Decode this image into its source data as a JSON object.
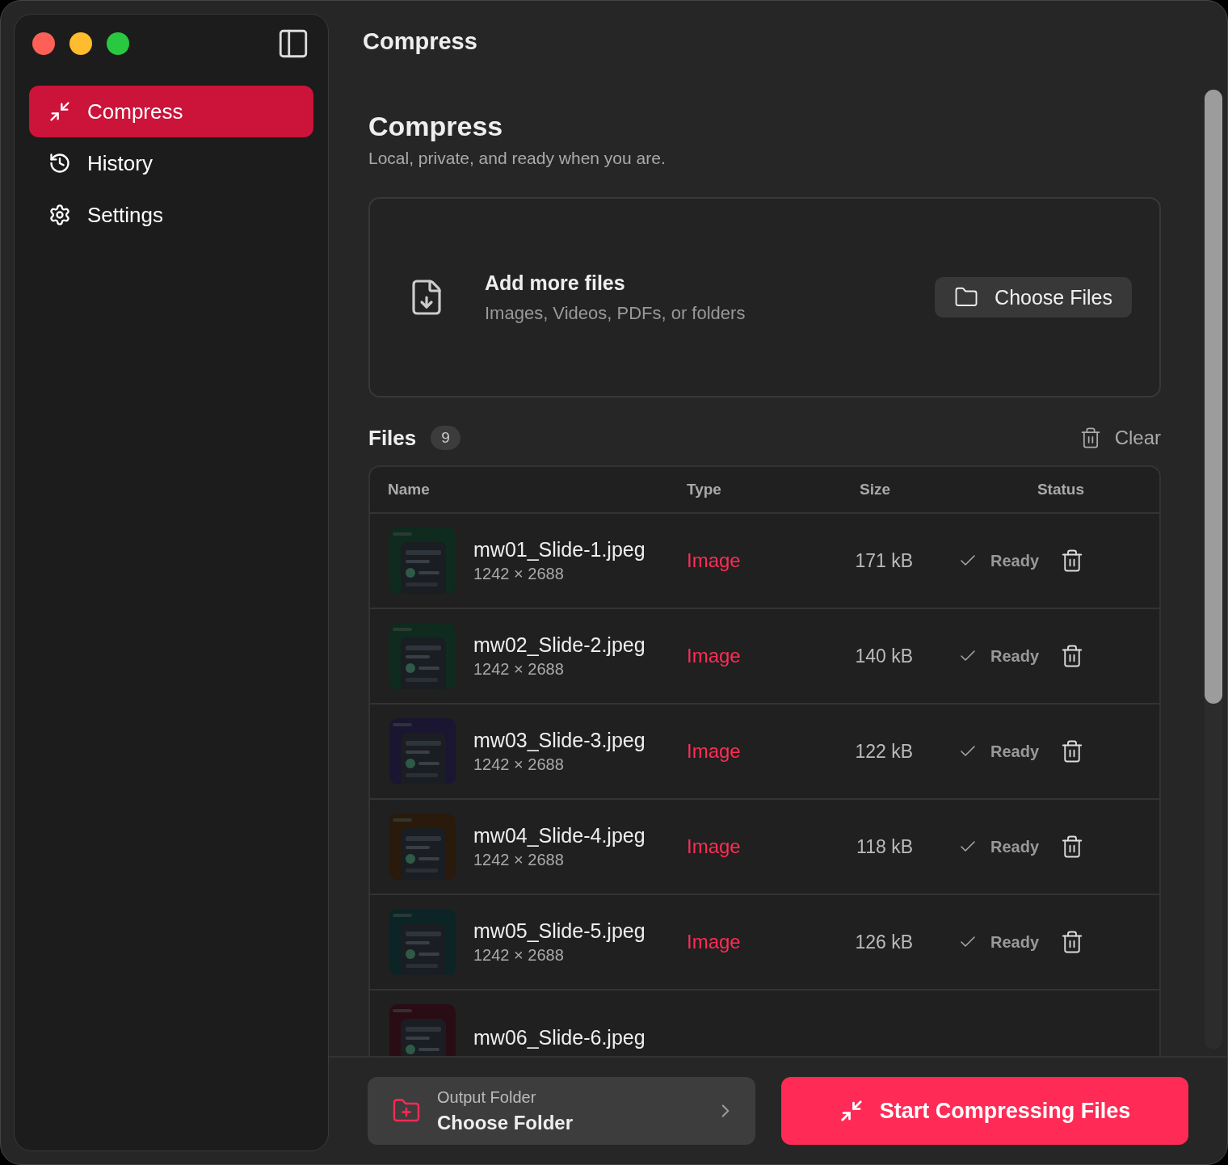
{
  "sidebar": {
    "items": [
      {
        "label": "Compress",
        "selected": true
      },
      {
        "label": "History",
        "selected": false
      },
      {
        "label": "Settings",
        "selected": false
      }
    ]
  },
  "title": "Compress",
  "header": {
    "title": "Compress",
    "subtitle": "Local, private, and ready when you are."
  },
  "dropzone": {
    "title": "Add more files",
    "subtitle": "Images, Videos, PDFs, or folders",
    "button": "Choose Files"
  },
  "files": {
    "title": "Files",
    "count": "9",
    "clear": "Clear",
    "columns": [
      "Name",
      "Type",
      "Size",
      "Status"
    ],
    "rows": [
      {
        "name": "mw01_Slide-1.jpeg",
        "dimensions": "1242 × 2688",
        "type": "Image",
        "size": "171 kB",
        "status": "Ready"
      },
      {
        "name": "mw02_Slide-2.jpeg",
        "dimensions": "1242 × 2688",
        "type": "Image",
        "size": "140 kB",
        "status": "Ready"
      },
      {
        "name": "mw03_Slide-3.jpeg",
        "dimensions": "1242 × 2688",
        "type": "Image",
        "size": "122 kB",
        "status": "Ready"
      },
      {
        "name": "mw04_Slide-4.jpeg",
        "dimensions": "1242 × 2688",
        "type": "Image",
        "size": "118 kB",
        "status": "Ready"
      },
      {
        "name": "mw05_Slide-5.jpeg",
        "dimensions": "1242 × 2688",
        "type": "Image",
        "size": "126 kB",
        "status": "Ready"
      },
      {
        "name": "mw06_Slide-6.jpeg"
      }
    ]
  },
  "footer": {
    "output_label": "Output Folder",
    "output_value": "Choose Folder",
    "start": "Start Compressing Files"
  }
}
